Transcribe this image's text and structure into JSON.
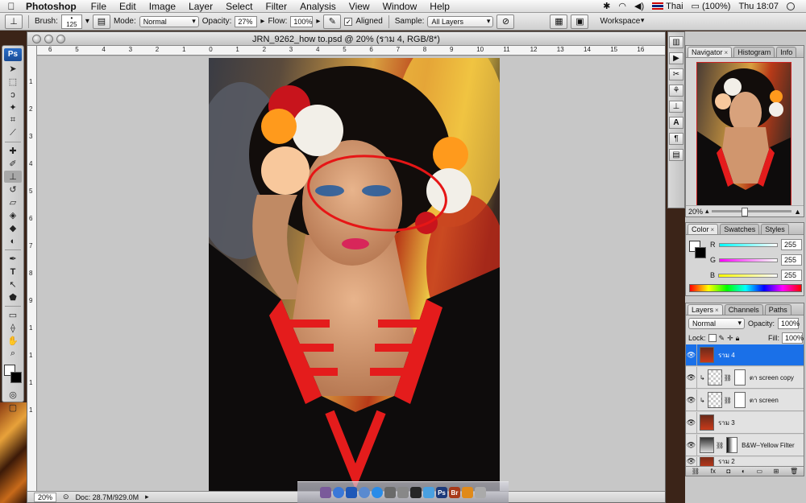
{
  "menubar": {
    "app_name": "Photoshop",
    "items": [
      "File",
      "Edit",
      "Image",
      "Layer",
      "Select",
      "Filter",
      "Analysis",
      "View",
      "Window",
      "Help"
    ],
    "input_lang": "Thai",
    "battery": "(100%)",
    "clock": "Thu 18:07"
  },
  "options": {
    "brush_label": "Brush:",
    "brush_size": "125",
    "mode_label": "Mode:",
    "mode_value": "Normal",
    "opacity_label": "Opacity:",
    "opacity_value": "27%",
    "flow_label": "Flow:",
    "flow_value": "100%",
    "aligned_label": "Aligned",
    "sample_label": "Sample:",
    "sample_value": "All Layers",
    "workspace_label": "Workspace"
  },
  "toolbox": {
    "logo": "Ps"
  },
  "document": {
    "title": "JRN_9262_how to.psd @ 20% (ราม 4, RGB/8*)",
    "hruler": [
      "6",
      "5",
      "4",
      "3",
      "2",
      "1",
      "0",
      "1",
      "2",
      "3",
      "4",
      "5",
      "6",
      "7",
      "8",
      "9",
      "10",
      "11",
      "12",
      "13",
      "14",
      "15",
      "16"
    ],
    "vruler": [
      "1",
      "2",
      "3",
      "4",
      "5",
      "6",
      "7",
      "8",
      "9",
      "1",
      "1",
      "1",
      "1"
    ],
    "zoom": "20%",
    "doc_size": "Doc: 28.7M/929.0M"
  },
  "navigator": {
    "tabs": [
      "Navigator",
      "Histogram",
      "Info"
    ],
    "zoom": "20%"
  },
  "color_panel": {
    "tabs": [
      "Color",
      "Swatches",
      "Styles"
    ],
    "channels": [
      {
        "label": "R",
        "value": "255"
      },
      {
        "label": "G",
        "value": "255"
      },
      {
        "label": "B",
        "value": "255"
      }
    ]
  },
  "layers_panel": {
    "tabs": [
      "Layers",
      "Channels",
      "Paths"
    ],
    "blend_mode": "Normal",
    "opacity_label": "Opacity:",
    "opacity_value": "100%",
    "lock_label": "Lock:",
    "fill_label": "Fill:",
    "fill_value": "100%",
    "layers": [
      {
        "name": "ราม 4"
      },
      {
        "name": "ตา screen copy"
      },
      {
        "name": "ตา screen"
      },
      {
        "name": "ราม 3"
      },
      {
        "name": "B&W–Yellow Filter"
      },
      {
        "name": "ราม 2"
      }
    ]
  },
  "dock": {
    "ps": "Ps",
    "br": "Br"
  }
}
